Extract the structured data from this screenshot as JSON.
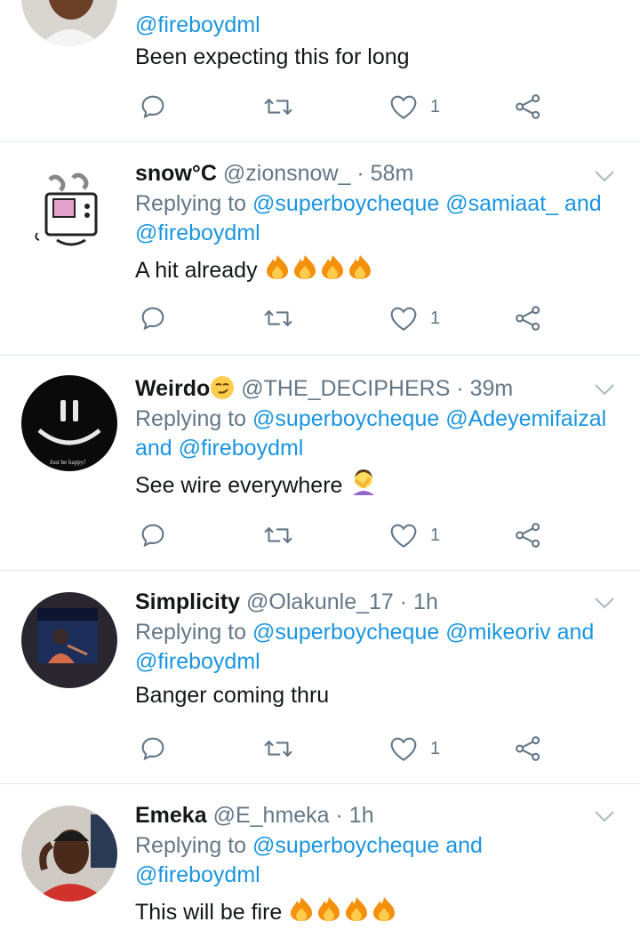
{
  "tweets": [
    {
      "reply_tail": "@fireboydml",
      "text": "Been expecting this for long",
      "likes": "1"
    },
    {
      "name": "snow°C",
      "handle": "@zionsnow_",
      "time": "· 58m",
      "reply_prefix": "Replying to",
      "mentions": "@superboycheque @samiaat_ and",
      "reply_tail": "@fireboydml",
      "text": "A hit already",
      "emoji": "fire-emoji-x4",
      "likes": "1"
    },
    {
      "name": "Weirdo",
      "name_emoji": "smirk-emoji",
      "handle": "@THE_DECIPHERS",
      "time": "· 39m",
      "reply_prefix": "Replying to",
      "mentions": "@superboycheque @Adeyemifaizal",
      "reply_tail": "and @fireboydml",
      "text": "See wire everywhere",
      "emoji": "facepalm-emoji",
      "avatar_caption": "Just be happy!",
      "likes": "1"
    },
    {
      "name": "Simplicity",
      "handle": "@Olakunle_17",
      "time": "· 1h",
      "reply_prefix": "Replying to",
      "mentions": "@superboycheque @mikeoriv and",
      "reply_tail": "@fireboydml",
      "text": "Banger coming thru",
      "likes": "1"
    },
    {
      "name": "Emeka",
      "handle": "@E_hmeka",
      "time": "· 1h",
      "reply_prefix": "Replying to",
      "mentions": "@superboycheque and",
      "reply_tail": "@fireboydml",
      "text": "This will be fire",
      "emoji": "fire-emoji-x4"
    }
  ],
  "colors": {
    "link": "#1b95e0",
    "muted": "#657786",
    "divider": "#e1e8ed"
  }
}
